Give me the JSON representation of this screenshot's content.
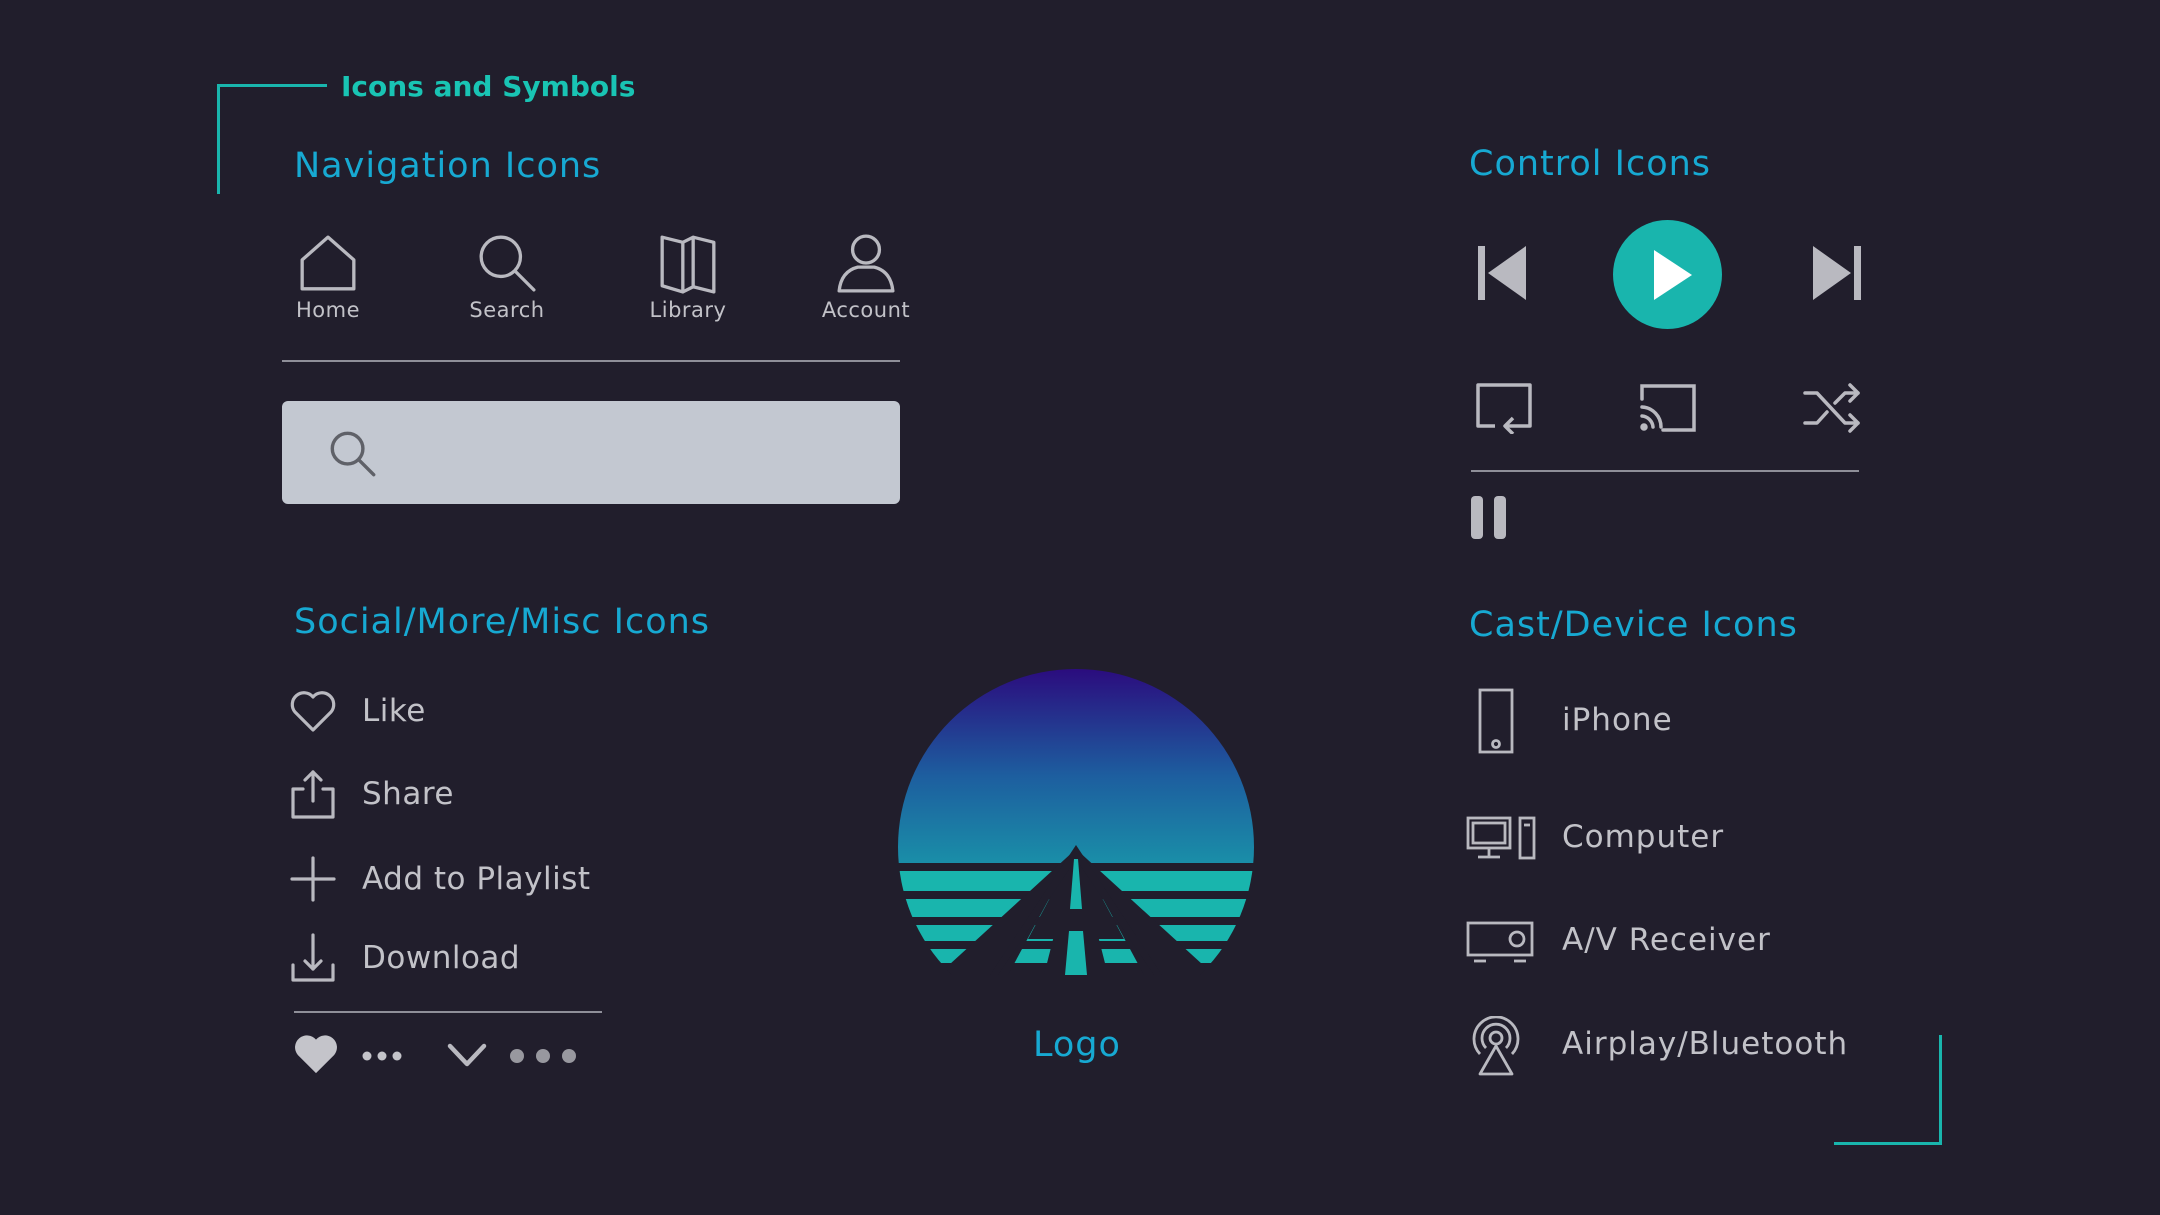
{
  "frame": {
    "title": "Icons and Symbols"
  },
  "navigation": {
    "title": "Navigation Icons",
    "items": [
      {
        "label": "Home",
        "icon": "home-icon"
      },
      {
        "label": "Search",
        "icon": "search-icon"
      },
      {
        "label": "Library",
        "icon": "library-icon"
      },
      {
        "label": "Account",
        "icon": "account-icon"
      }
    ],
    "search_placeholder": ""
  },
  "controls": {
    "title": "Control Icons",
    "icons": [
      "skip-back-icon",
      "play-icon",
      "skip-forward-icon",
      "repeat-icon",
      "cast-icon",
      "shuffle-icon",
      "pause-icon"
    ]
  },
  "social": {
    "title": "Social/More/Misc Icons",
    "items": [
      {
        "label": "Like",
        "icon": "heart-outline-icon"
      },
      {
        "label": "Share",
        "icon": "share-icon"
      },
      {
        "label": "Add to Playlist",
        "icon": "plus-icon"
      },
      {
        "label": "Download",
        "icon": "download-icon"
      }
    ],
    "extra_icons": [
      "heart-filled-icon",
      "more-horizontal-small-icon",
      "chevron-down-icon",
      "more-horizontal-icon"
    ]
  },
  "logo": {
    "label": "Logo"
  },
  "devices": {
    "title": "Cast/Device Icons",
    "items": [
      {
        "label": "iPhone",
        "icon": "phone-icon"
      },
      {
        "label": "Computer",
        "icon": "computer-icon"
      },
      {
        "label": "A/V Receiver",
        "icon": "av-receiver-icon"
      },
      {
        "label": "Airplay/Bluetooth",
        "icon": "airplay-icon"
      }
    ]
  },
  "colors": {
    "background": "#211e2c",
    "accent": "#17a9d2",
    "teal": "#19b5ad",
    "icon": "#b9b9c0",
    "search_bg": "#c3c8d1"
  }
}
